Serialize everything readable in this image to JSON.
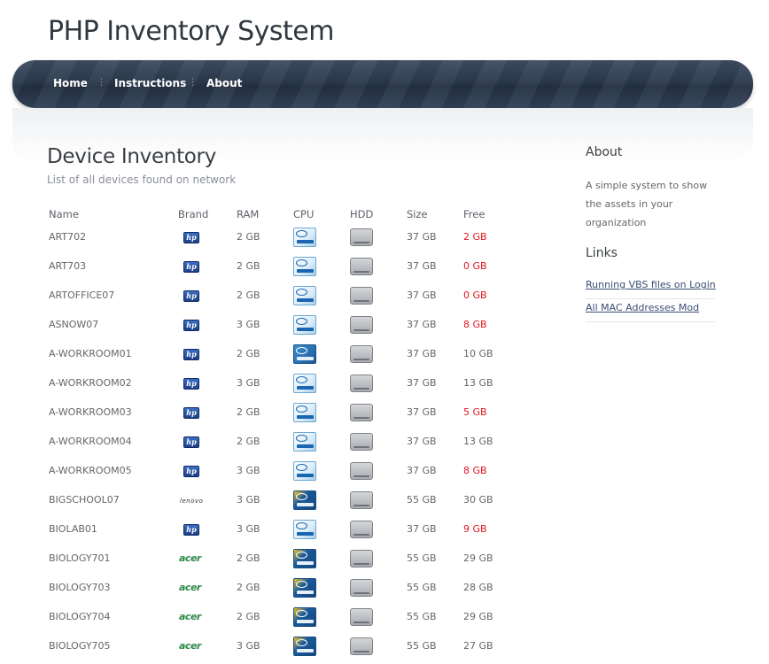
{
  "site": {
    "title": "PHP Inventory System"
  },
  "nav": {
    "items": [
      {
        "label": "Home"
      },
      {
        "label": "Instructions"
      },
      {
        "label": "About"
      }
    ],
    "separator": "⋮"
  },
  "main": {
    "heading": "Device Inventory",
    "subtitle": "List of all devices found on network",
    "columns": [
      "Name",
      "Brand",
      "RAM",
      "CPU",
      "HDD",
      "Size",
      "Free"
    ],
    "rows": [
      {
        "name": "ART702",
        "brand": "hp",
        "ram": "2 GB",
        "cpu": "pentium",
        "size": "37 GB",
        "free": "2 GB",
        "free_alert": true
      },
      {
        "name": "ART703",
        "brand": "hp",
        "ram": "2 GB",
        "cpu": "pentium",
        "size": "37 GB",
        "free": "0 GB",
        "free_alert": true
      },
      {
        "name": "ARTOFFICE07",
        "brand": "hp",
        "ram": "2 GB",
        "cpu": "pentium",
        "size": "37 GB",
        "free": "0 GB",
        "free_alert": true
      },
      {
        "name": "ASNOW07",
        "brand": "hp",
        "ram": "3 GB",
        "cpu": "pentium",
        "size": "37 GB",
        "free": "8 GB",
        "free_alert": true
      },
      {
        "name": "A-WORKROOM01",
        "brand": "hp",
        "ram": "2 GB",
        "cpu": "core-i",
        "size": "37 GB",
        "free": "10 GB",
        "free_alert": false
      },
      {
        "name": "A-WORKROOM02",
        "brand": "hp",
        "ram": "3 GB",
        "cpu": "pentium",
        "size": "37 GB",
        "free": "13 GB",
        "free_alert": false
      },
      {
        "name": "A-WORKROOM03",
        "brand": "hp",
        "ram": "2 GB",
        "cpu": "pentium",
        "size": "37 GB",
        "free": "5 GB",
        "free_alert": true
      },
      {
        "name": "A-WORKROOM04",
        "brand": "hp",
        "ram": "2 GB",
        "cpu": "pentium",
        "size": "37 GB",
        "free": "13 GB",
        "free_alert": false
      },
      {
        "name": "A-WORKROOM05",
        "brand": "hp",
        "ram": "3 GB",
        "cpu": "pentium",
        "size": "37 GB",
        "free": "8 GB",
        "free_alert": true
      },
      {
        "name": "BIGSCHOOL07",
        "brand": "lenovo",
        "ram": "3 GB",
        "cpu": "core2",
        "size": "55 GB",
        "free": "30 GB",
        "free_alert": false
      },
      {
        "name": "BIOLAB01",
        "brand": "hp",
        "ram": "3 GB",
        "cpu": "pentium",
        "size": "37 GB",
        "free": "9 GB",
        "free_alert": true
      },
      {
        "name": "BIOLOGY701",
        "brand": "acer",
        "ram": "2 GB",
        "cpu": "core2",
        "size": "55 GB",
        "free": "29 GB",
        "free_alert": false
      },
      {
        "name": "BIOLOGY703",
        "brand": "acer",
        "ram": "2 GB",
        "cpu": "core2",
        "size": "55 GB",
        "free": "28 GB",
        "free_alert": false
      },
      {
        "name": "BIOLOGY704",
        "brand": "acer",
        "ram": "2 GB",
        "cpu": "core2",
        "size": "55 GB",
        "free": "29 GB",
        "free_alert": false
      },
      {
        "name": "BIOLOGY705",
        "brand": "acer",
        "ram": "3 GB",
        "cpu": "core2",
        "size": "55 GB",
        "free": "27 GB",
        "free_alert": false
      }
    ],
    "brand_logos": {
      "hp": "hp",
      "lenovo": "lenovo",
      "acer": "acer"
    },
    "cpu_icons": {
      "pentium": "intel-pentium-icon",
      "core-i": "intel-core-i-icon",
      "core2": "intel-core2-icon"
    },
    "hdd_icon": "hard-drive-icon",
    "colors": {
      "alert": "#e0141e",
      "link": "#394f73",
      "nav_bg": "#2c3a4d"
    }
  },
  "sidebar": {
    "about_heading": "About",
    "about_text": "A simple system to show the assets in your organization",
    "links_heading": "Links",
    "links": [
      {
        "label": "Running VBS files on Login"
      },
      {
        "label": "All MAC Addresses Mod"
      }
    ]
  }
}
